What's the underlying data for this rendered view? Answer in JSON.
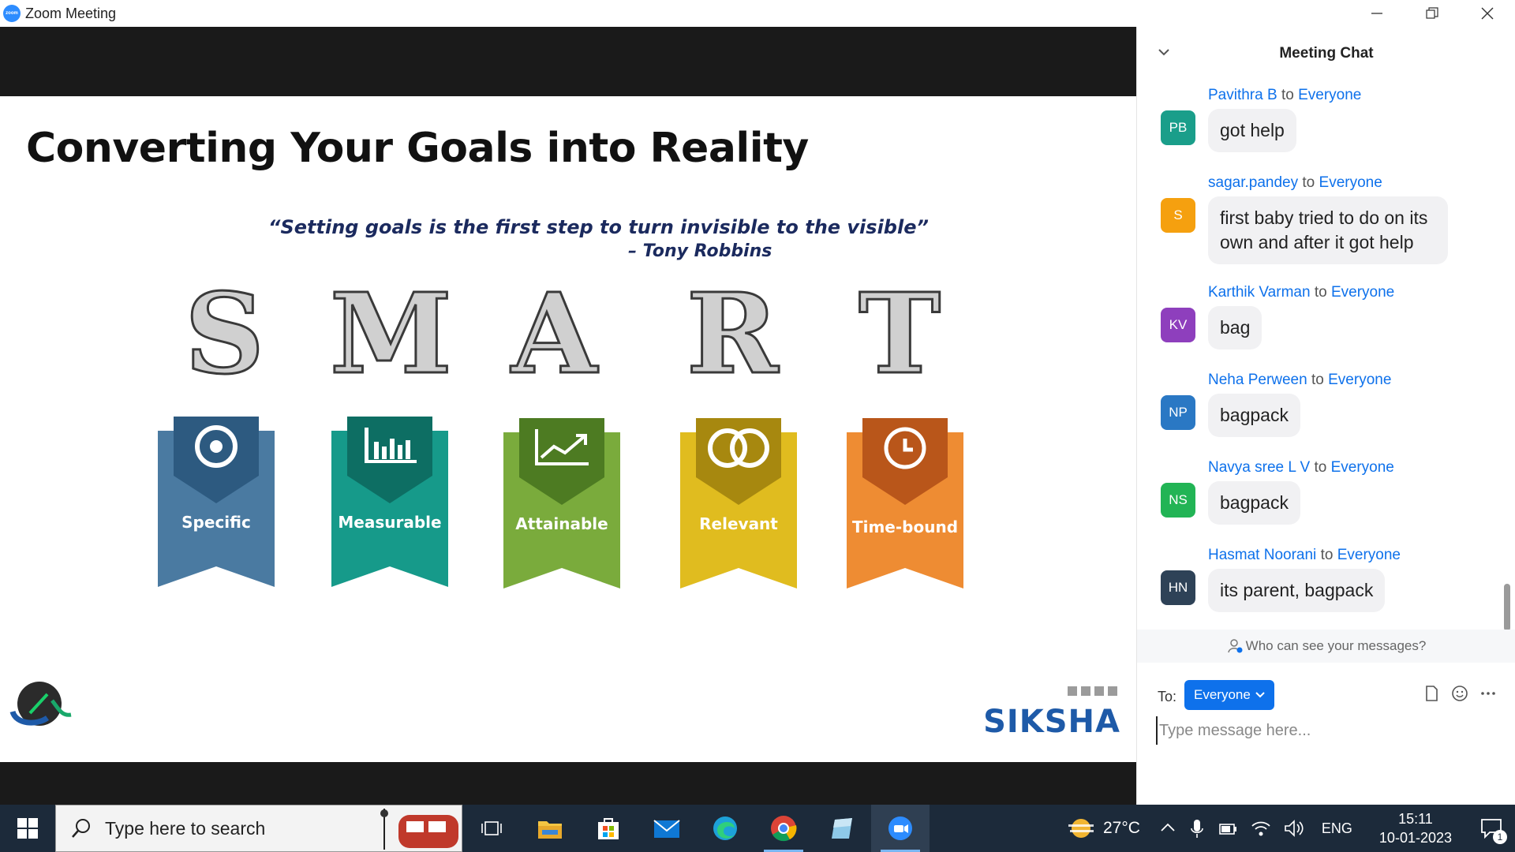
{
  "window": {
    "title": "Zoom Meeting",
    "logo_text": "zoom"
  },
  "slide": {
    "title": "Converting Your Goals into Reality",
    "quote": "“Setting goals is the first step to turn invisible to the visible”",
    "author": "– Tony Robbins",
    "smart": [
      {
        "letter": "S",
        "label": "Specific",
        "color": "#4a7aa1",
        "dark": "#2d5a80"
      },
      {
        "letter": "M",
        "label": "Measurable",
        "color": "#169a8a",
        "dark": "#0d6e63"
      },
      {
        "letter": "A",
        "label": "Attainable",
        "color": "#7aab3c",
        "dark": "#4d7b22"
      },
      {
        "letter": "R",
        "label": "Relevant",
        "color": "#e0bc1f",
        "dark": "#a7880f"
      },
      {
        "letter": "T",
        "label": "Time-bound",
        "color": "#ee8c33",
        "dark": "#b9561a"
      }
    ],
    "brand": "SIKSHA"
  },
  "chat": {
    "title": "Meeting Chat",
    "messages": [
      {
        "initials": "PB",
        "color": "#1a9e8a",
        "sender": "Pavithra B",
        "to": "to",
        "recipient": "Everyone",
        "text": "got help"
      },
      {
        "initials": "S",
        "color": "#f5a00f",
        "sender": "sagar.pandey",
        "to": "to",
        "recipient": "Everyone",
        "text": "first baby tried to do on its own and after it got help"
      },
      {
        "initials": "KV",
        "color": "#8e3fbd",
        "sender": "Karthik Varman",
        "to": "to",
        "recipient": "Everyone",
        "text": "bag"
      },
      {
        "initials": "NP",
        "color": "#2a78c4",
        "sender": "Neha Perween",
        "to": "to",
        "recipient": "Everyone",
        "text": "bagpack"
      },
      {
        "initials": "NS",
        "color": "#22b455",
        "sender": "Navya sree L V",
        "to": "to",
        "recipient": "Everyone",
        "text": "bagpack"
      },
      {
        "initials": "HN",
        "color": "#2e4257",
        "sender": "Hasmat Noorani",
        "to": "to",
        "recipient": "Everyone",
        "text": "its parent, bagpack"
      }
    ],
    "privacy": "Who can see your messages?",
    "to_label": "To:",
    "recipient": "Everyone",
    "input_placeholder": "Type message here..."
  },
  "taskbar": {
    "search_placeholder": "Type here to search",
    "temperature": "27°C",
    "language": "ENG",
    "time": "15:11",
    "date": "10-01-2023",
    "notifications": "1"
  }
}
